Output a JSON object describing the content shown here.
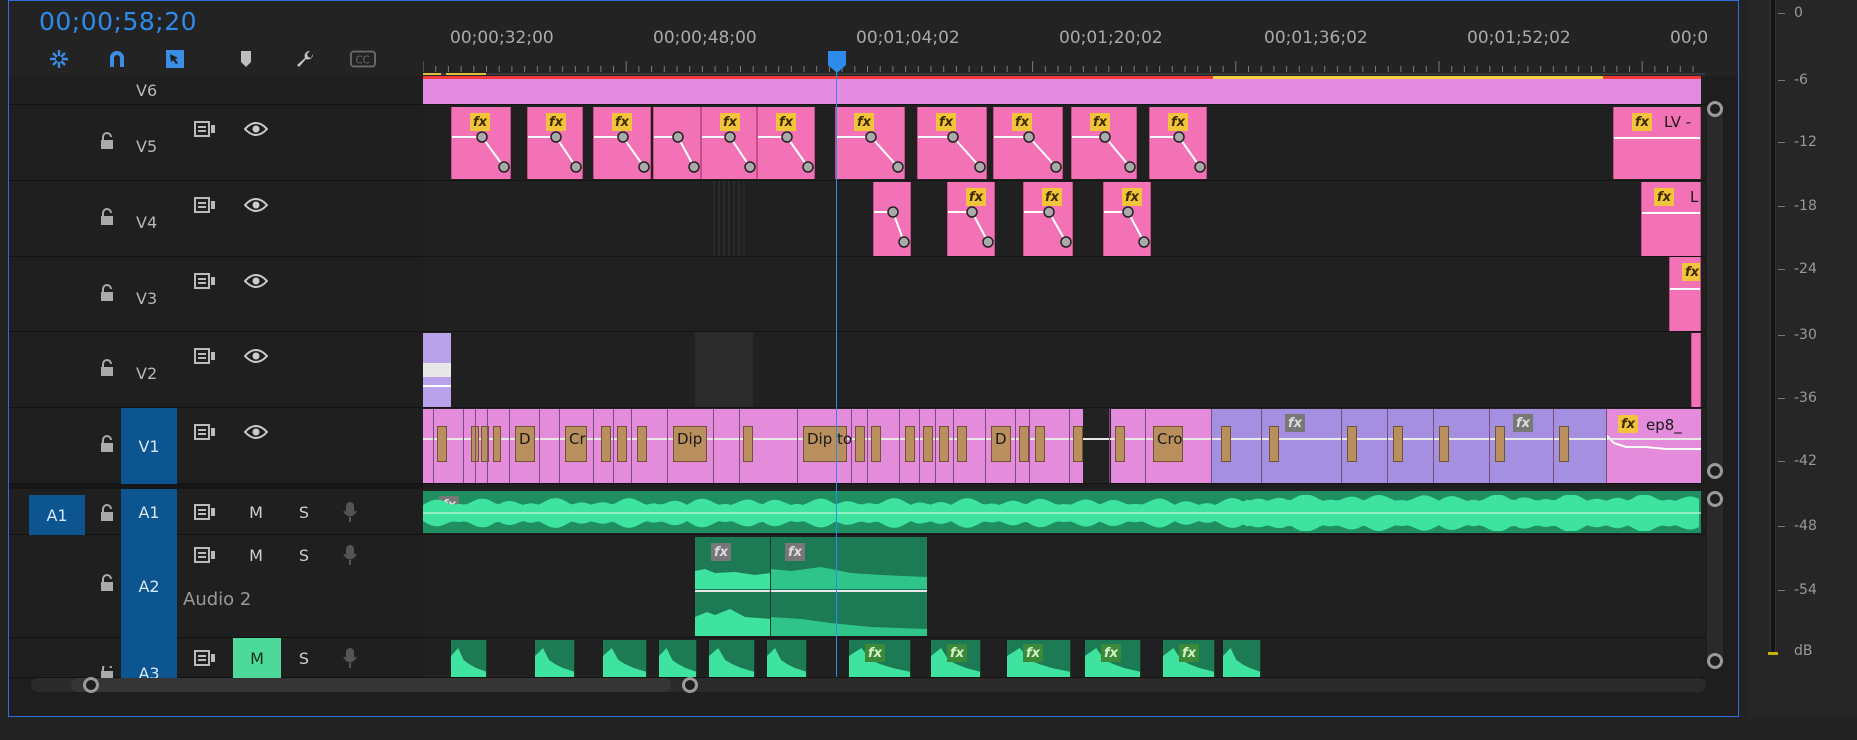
{
  "timeline": {
    "timecode": "00;00;58;20",
    "ruler_labels": [
      "00;00;32;00",
      "00;00;48;00",
      "00;01;04;02",
      "00;01;20;02",
      "00;01;36;02",
      "00;01;52;02",
      "00;0"
    ],
    "tools": [
      "snap-icon",
      "magnet-icon",
      "linked-selection-icon",
      "marker-icon",
      "wrench-icon",
      "captions-icon"
    ]
  },
  "video_tracks": [
    {
      "id": "V6",
      "label": "V6"
    },
    {
      "id": "V5",
      "label": "V5"
    },
    {
      "id": "V4",
      "label": "V4"
    },
    {
      "id": "V3",
      "label": "V3"
    },
    {
      "id": "V2",
      "label": "V2"
    },
    {
      "id": "V1",
      "label": "V1",
      "target": "V1"
    }
  ],
  "audio_tracks": [
    {
      "id": "A1",
      "label": "A1",
      "source": "A1",
      "mute": "M",
      "solo": "S"
    },
    {
      "id": "A2",
      "label": "A2",
      "name": "Audio 2",
      "mute": "M",
      "solo": "S"
    },
    {
      "id": "A3",
      "label": "A3",
      "mute": "M",
      "solo": "S"
    }
  ],
  "clip_labels": {
    "fx": "fx",
    "lv": "LV -",
    "l": "L",
    "ep8": "ep8_",
    "dip": "Dip",
    "dipto": "Dip to",
    "cr": "Cr",
    "cro": "Cro",
    "d": "D"
  },
  "meter": {
    "labels": [
      "0",
      "-6",
      "-12",
      "-18",
      "-24",
      "-30",
      "-36",
      "-42",
      "-48",
      "-54",
      "dB"
    ]
  },
  "colors": {
    "accent": "#2d8ceb",
    "video_pink": "#f272b5",
    "v1_pink": "#e58bdc",
    "v1_purple": "#a58fe0",
    "audio_green": "#2fbf82",
    "fx_yellow": "#f2c43b",
    "target_blue": "#0c5590"
  }
}
